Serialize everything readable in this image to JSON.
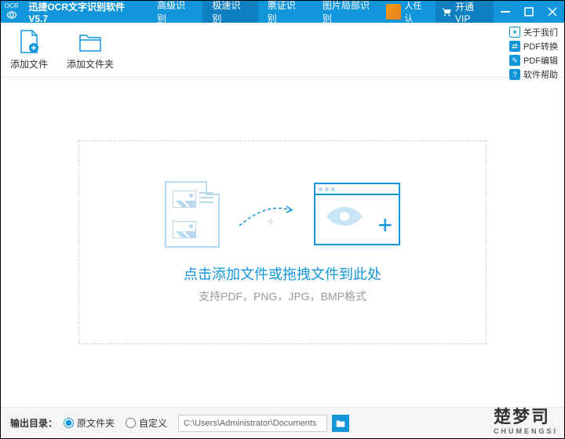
{
  "app": {
    "title": "迅捷OCR文字识别软件V5.7",
    "logo_text": "OCR"
  },
  "tabs": [
    {
      "label": "高级识别"
    },
    {
      "label": "极速识别"
    },
    {
      "label": "票证识别"
    },
    {
      "label": "图片局部识别"
    }
  ],
  "user": {
    "name": "人任认"
  },
  "vip": {
    "label": "开通VIP"
  },
  "toolbar": {
    "add_file": "添加文件",
    "add_folder": "添加文件夹"
  },
  "side_links": {
    "about": "关于我们",
    "pdf_convert": "PDF转换",
    "pdf_edit": "PDF编辑",
    "help": "软件帮助"
  },
  "dropzone": {
    "title": "点击添加文件或拖拽文件到此处",
    "subtitle": "支持PDF，PNG，JPG，BMP格式"
  },
  "footer": {
    "label": "输出目录：",
    "opt_original": "原文件夹",
    "opt_custom": "自定义",
    "path": "C:\\Users\\Administrator\\Documents"
  },
  "watermark": {
    "cn": "楚梦司",
    "en": "CHUMENGSI"
  }
}
